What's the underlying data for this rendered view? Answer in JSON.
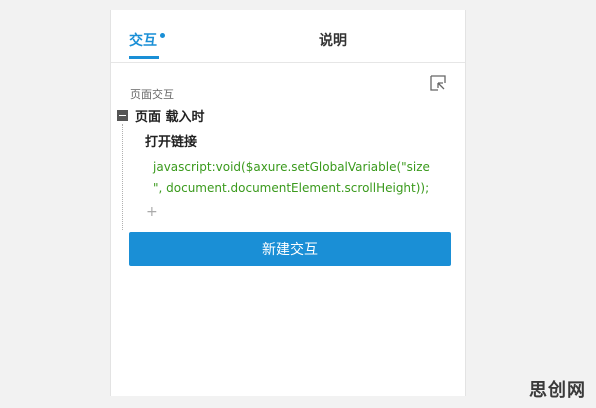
{
  "tabs": {
    "interaction": "交互",
    "notes": "说明"
  },
  "section": {
    "label": "页面交互"
  },
  "event": {
    "label": "页面 载入时"
  },
  "action": {
    "label": "打开链接",
    "code": "javascript:void($axure.setGlobalVariable(\"size\n\", document.documentElement.scrollHeight));"
  },
  "add_action": {
    "symbol": "+"
  },
  "new_interaction": {
    "label": "新建交互"
  },
  "watermark": {
    "text": "思创网"
  },
  "colors": {
    "accent": "#1a8fd6",
    "code": "#3a9a1c"
  },
  "icons": [
    "pin-icon",
    "collapse-icon"
  ]
}
